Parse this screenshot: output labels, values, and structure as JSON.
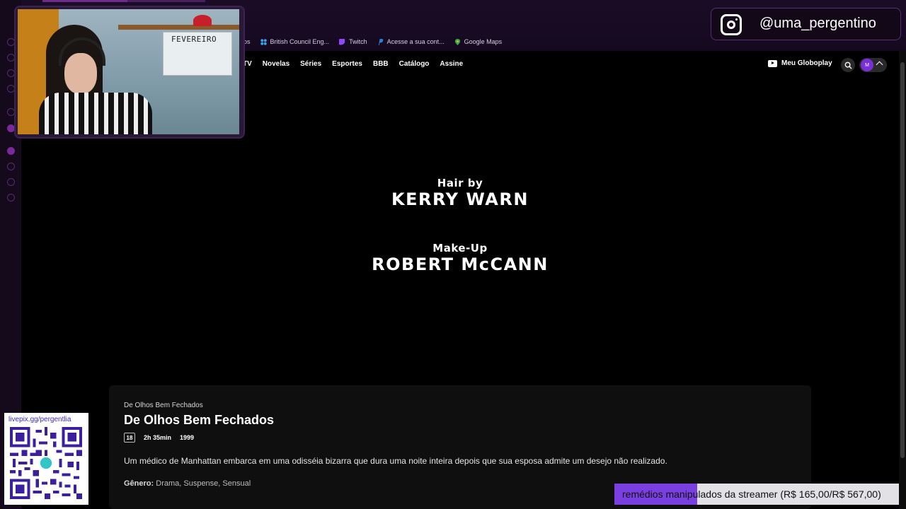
{
  "browser": {
    "bookmarks": [
      {
        "label": "ros",
        "icon": "bookmark-icon"
      },
      {
        "label": "British Council Eng...",
        "icon": "british-council-icon"
      },
      {
        "label": "Twitch",
        "icon": "twitch-icon"
      },
      {
        "label": "Acesse a sua cont...",
        "icon": "paypal-icon"
      },
      {
        "label": "Google Maps",
        "icon": "maps-pin-icon"
      }
    ]
  },
  "site": {
    "nav": [
      "TV",
      "Novelas",
      "Séries",
      "Esportes",
      "BBB",
      "Catálogo",
      "Assine"
    ],
    "meu_label": "Meu Globoplay",
    "avatar_initial": "M"
  },
  "credits": [
    {
      "role": "Hair by",
      "name": "KERRY WARN"
    },
    {
      "role": "Make-Up",
      "name": "ROBERT McCANN"
    }
  ],
  "info": {
    "breadcrumb": "De Olhos Bem Fechados",
    "title": "De Olhos Bem Fechados",
    "rating": "18",
    "duration": "2h 35min",
    "year": "1999",
    "synopsis": "Um médico de Manhattan embarca em uma odisséia bizarra que dura uma noite inteira depois que sua esposa admite um desejo não realizado.",
    "genre_label": "Gênero:",
    "genres": "Drama, Suspense, Sensual"
  },
  "overlay": {
    "webcam_board_text": "FEVEREIRO",
    "instagram_handle": "@uma_pergentino",
    "qr_label": "livepix.gg/pergentlia",
    "ticker_text": "remédios manipulados da streamer (R$ 165,00/R$ 567,00)",
    "ticker_progress": 0.291
  },
  "colors": {
    "accent": "#7a3fe0",
    "chrome_bg": "#1b0c25",
    "card_bg": "#0f0f10"
  }
}
